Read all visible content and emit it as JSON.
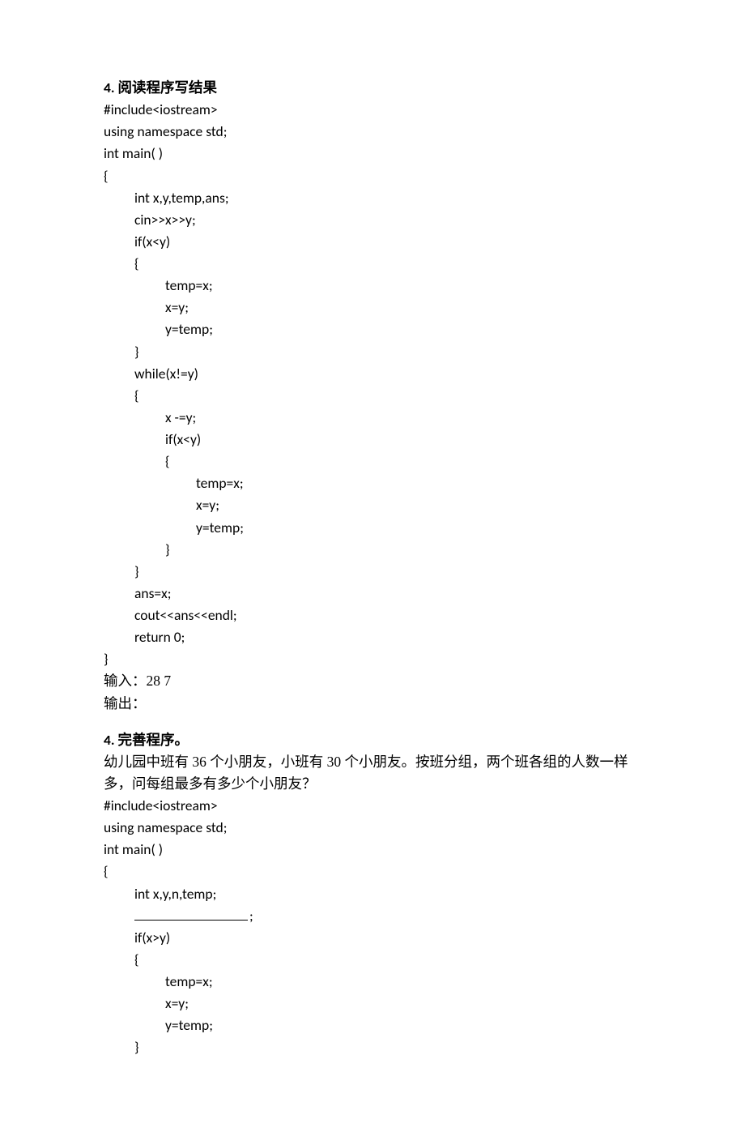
{
  "section1": {
    "heading": "4. 阅读程序写结果",
    "code": [
      {
        "t": "#include<iostream>",
        "i": 0
      },
      {
        "t": "using namespace std;",
        "i": 0
      },
      {
        "t": "int main( )",
        "i": 0
      },
      {
        "t": "{",
        "i": 0
      },
      {
        "t": "int x,y,temp,ans;",
        "i": 1
      },
      {
        "t": "cin>>x>>y;",
        "i": 1
      },
      {
        "t": "if(x<y)",
        "i": 1
      },
      {
        "t": "{",
        "i": 1
      },
      {
        "t": "temp=x;",
        "i": 2
      },
      {
        "t": "x=y;",
        "i": 2
      },
      {
        "t": "y=temp;",
        "i": 2
      },
      {
        "t": "}",
        "i": 1
      },
      {
        "t": "while(x!=y)",
        "i": 1
      },
      {
        "t": "{",
        "i": 1
      },
      {
        "t": "x -=y;",
        "i": 2
      },
      {
        "t": "if(x<y)",
        "i": 2
      },
      {
        "t": "{",
        "i": 2
      },
      {
        "t": "temp=x;",
        "i": 3
      },
      {
        "t": "x=y;",
        "i": 3
      },
      {
        "t": "y=temp;",
        "i": 3
      },
      {
        "t": "}",
        "i": 2
      },
      {
        "t": "}",
        "i": 1
      },
      {
        "t": "ans=x;",
        "i": 1
      },
      {
        "t": "cout<<ans<<endl;",
        "i": 1
      },
      {
        "t": "return 0;",
        "i": 1
      },
      {
        "t": "}",
        "i": 0
      }
    ],
    "input_line": "输入：28   7",
    "output_line": "输出："
  },
  "section2": {
    "heading": "4. 完善程序。",
    "desc_line1": "幼儿园中班有 36 个小朋友，小班有 30 个小朋友。按班分组，两个班各组的人数一样",
    "desc_line2": "多，问每组最多有多少个小朋友？",
    "code": [
      {
        "t": "#include<iostream>",
        "i": 0
      },
      {
        "t": "using namespace std;",
        "i": 0
      },
      {
        "t": "int main( )",
        "i": 0
      },
      {
        "t": "{",
        "i": 0
      },
      {
        "t": "int x,y,n,temp;",
        "i": 1
      },
      {
        "blank": true,
        "after": ";",
        "i": 1
      },
      {
        "t": "if(x>y)",
        "i": 1
      },
      {
        "t": "{",
        "i": 1
      },
      {
        "t": "temp=x;",
        "i": 2
      },
      {
        "t": "x=y;",
        "i": 2
      },
      {
        "t": "y=temp;",
        "i": 2
      },
      {
        "t": "}",
        "i": 1
      }
    ]
  }
}
